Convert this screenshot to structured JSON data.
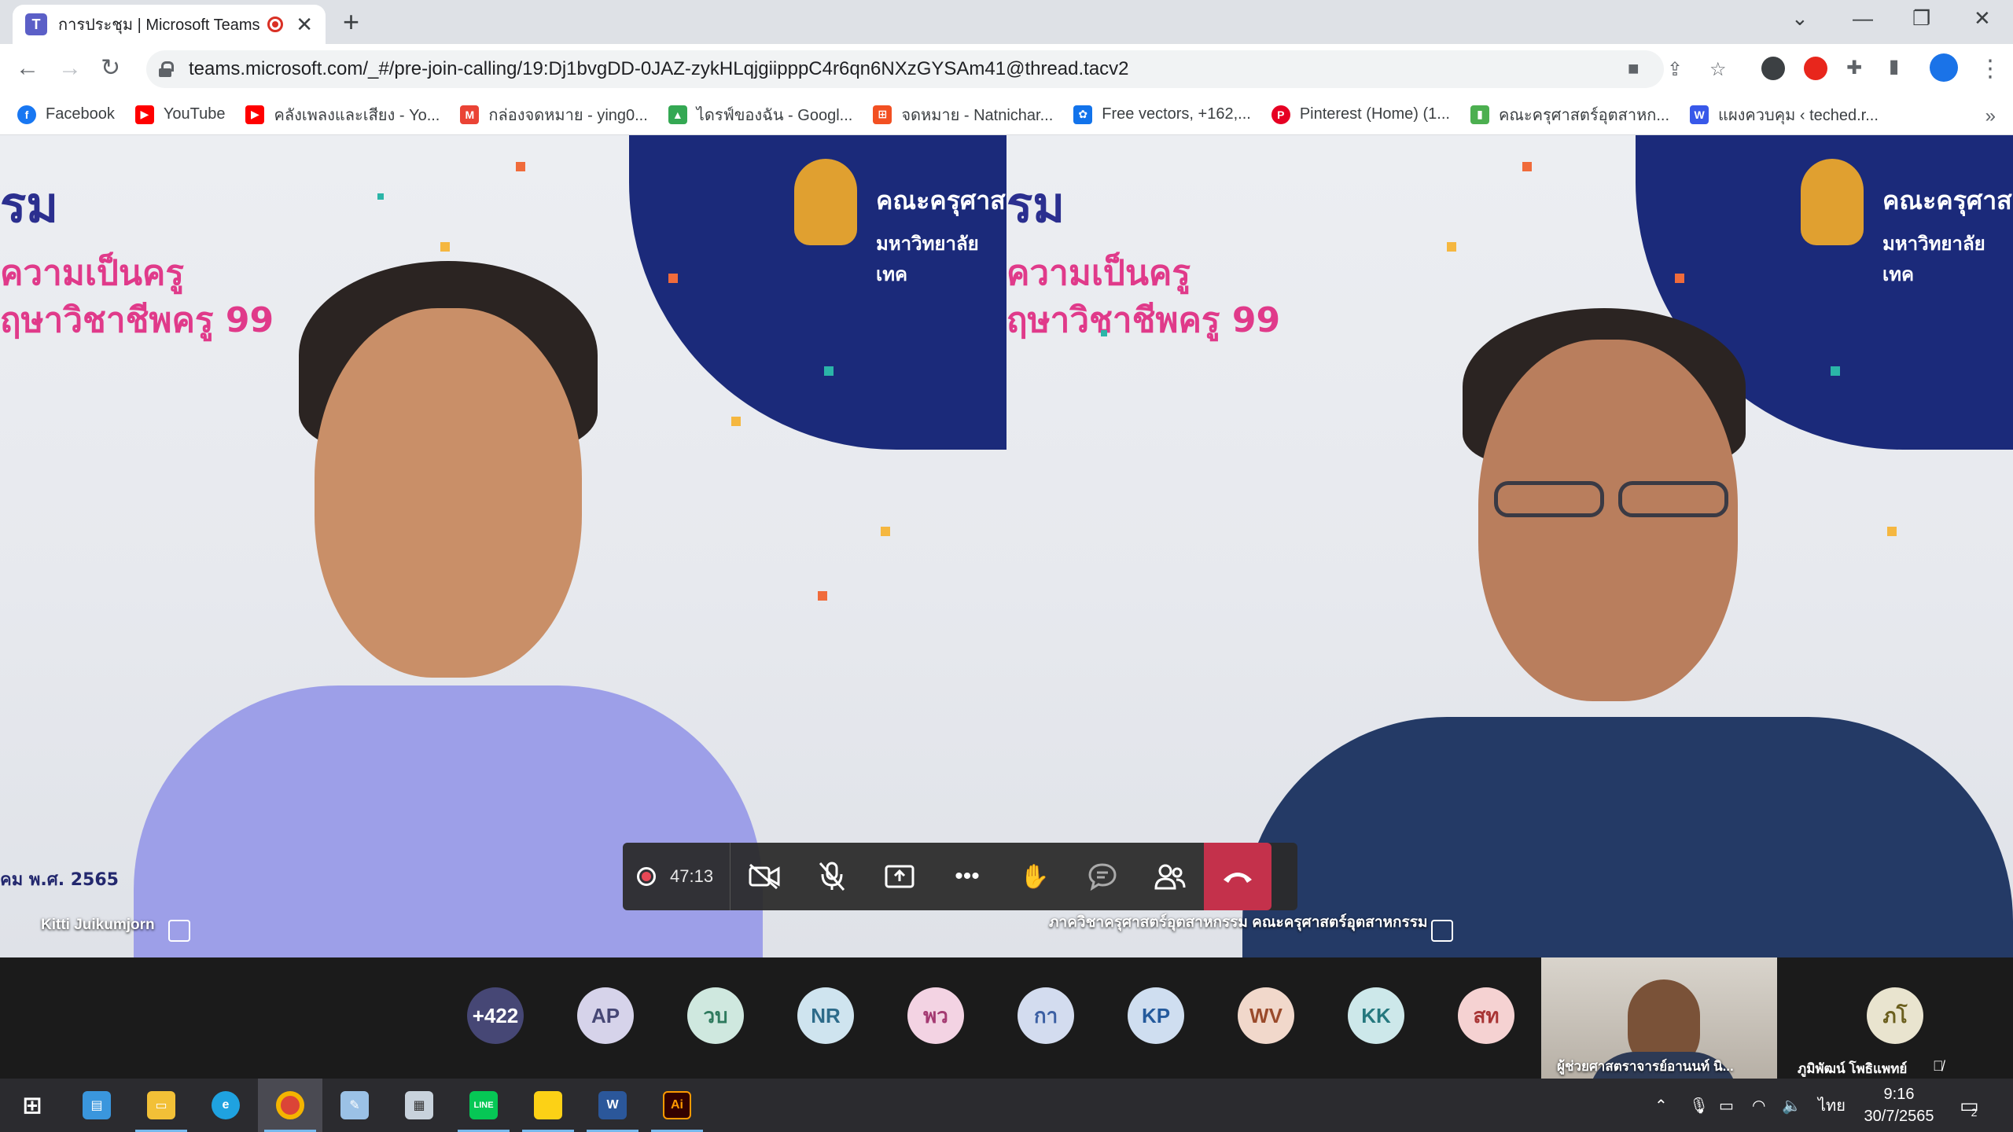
{
  "browser": {
    "tab_title": "การประชุม | Microsoft Teams",
    "url": "teams.microsoft.com/_#/pre-join-calling/19:Dj1bvgDD-0JAZ-zykHLqjgiipppC4r6qn6NXzGYSAm41@thread.tacv2",
    "bookmarks": [
      {
        "label": "Facebook",
        "icon": "facebook-icon",
        "color": "#1877f2",
        "glyph": "f"
      },
      {
        "label": "YouTube",
        "icon": "youtube-icon",
        "color": "#ff0000",
        "glyph": "▶"
      },
      {
        "label": "คลังเพลงและเสียง - Yo...",
        "icon": "youtube-icon",
        "color": "#ff0000",
        "glyph": "▶"
      },
      {
        "label": "กล่องจดหมาย - ying0...",
        "icon": "gmail-icon",
        "color": "#ea4335",
        "glyph": "M"
      },
      {
        "label": "ไดรฟ์ของฉัน - Googl...",
        "icon": "google-drive-icon",
        "color": "#34a853",
        "glyph": "▲"
      },
      {
        "label": "จดหมาย - Natnichar...",
        "icon": "microsoft-icon",
        "color": "#f25022",
        "glyph": "⊞"
      },
      {
        "label": "Free vectors, +162,...",
        "icon": "freepik-icon",
        "color": "#1273eb",
        "glyph": "✿"
      },
      {
        "label": "Pinterest (Home) (1...",
        "icon": "pinterest-icon",
        "color": "#e60023",
        "glyph": "P"
      },
      {
        "label": "คณะครุศาสตร์อุตสาหก...",
        "icon": "bookmark-page-icon",
        "color": "#4caf50",
        "glyph": "▮"
      },
      {
        "label": "แผงควบคุม ‹ teched.r...",
        "icon": "wordpress-icon",
        "color": "#3858e9",
        "glyph": "W"
      }
    ],
    "more_bookmarks": "»"
  },
  "meeting": {
    "timer": "47:13",
    "left_video": {
      "name": "Kitti Juikumjorn",
      "bg_heading": "รม",
      "bg_line1": "ความเป็นครู",
      "bg_line2": "ฤษาวิชาชีพครู 99",
      "bg_org1": "คณะครุศาส",
      "bg_org2": "มหาวิทยาลัยเทค",
      "date_caption": "คม พ.ศ. 2565"
    },
    "right_video": {
      "name": "ภาควิชาครุศาสตร์อุตสาหกรรม คณะครุศาสตร์อุตสาหกรรม",
      "bg_heading": "รม",
      "bg_line1": "ความเป็นครู",
      "bg_line2": "ฤษาวิชาชีพครู 99",
      "bg_org1": "คณะครุศาส",
      "bg_org2": "มหาวิทยาลัยเทค"
    },
    "participants": [
      {
        "initials": "+422",
        "bg": "#464775",
        "fg": "#ffffff"
      },
      {
        "initials": "AP",
        "bg": "#d6d3ea",
        "fg": "#464775"
      },
      {
        "initials": "วบ",
        "bg": "#cfe8df",
        "fg": "#2e7a5e"
      },
      {
        "initials": "NR",
        "bg": "#cfe4ef",
        "fg": "#2d6b8a"
      },
      {
        "initials": "พว",
        "bg": "#f3d3e3",
        "fg": "#a43a72"
      },
      {
        "initials": "กา",
        "bg": "#d3dcef",
        "fg": "#3b5fa3"
      },
      {
        "initials": "KP",
        "bg": "#cfdef0",
        "fg": "#245a9c"
      },
      {
        "initials": "WV",
        "bg": "#f1d8cb",
        "fg": "#9a4a2b"
      },
      {
        "initials": "KK",
        "bg": "#cde8ea",
        "fg": "#25787e"
      },
      {
        "initials": "สท",
        "bg": "#f5d2d2",
        "fg": "#a83434"
      }
    ],
    "thumbnail_name": "ผู้ช่วยศาสตราจารย์อานนท์ นิ...",
    "last_participant": {
      "initials": "ภโ",
      "name": "ภูมิพัฒน์ โพธิแพทย์",
      "bg": "#e9e4cf",
      "fg": "#6b5f1e"
    }
  },
  "taskbar": {
    "apps": [
      {
        "name": "start-icon",
        "color": "#ffffff",
        "glyph": "⊞"
      },
      {
        "name": "news-app-icon",
        "color": "#3a96dd",
        "glyph": "▤"
      },
      {
        "name": "file-explorer-icon",
        "color": "#f2c037",
        "glyph": "▭"
      },
      {
        "name": "edge-icon",
        "color": "#1fa2e0",
        "glyph": "e"
      },
      {
        "name": "chrome-icon",
        "color": "#db4437",
        "glyph": "◉"
      },
      {
        "name": "paint-icon",
        "color": "#9bc1e6",
        "glyph": "✎"
      },
      {
        "name": "scanner-icon",
        "color": "#c8d2dc",
        "glyph": "▦"
      },
      {
        "name": "line-icon",
        "color": "#06c755",
        "glyph": "LINE"
      },
      {
        "name": "sticky-notes-icon",
        "color": "#fcd116",
        "glyph": "▰"
      },
      {
        "name": "word-icon",
        "color": "#2b579a",
        "glyph": "W"
      },
      {
        "name": "illustrator-icon",
        "color": "#330000",
        "glyph": "Ai"
      }
    ],
    "language": "ไทย",
    "time": "9:16",
    "date": "30/7/2565",
    "notifications": "2"
  }
}
